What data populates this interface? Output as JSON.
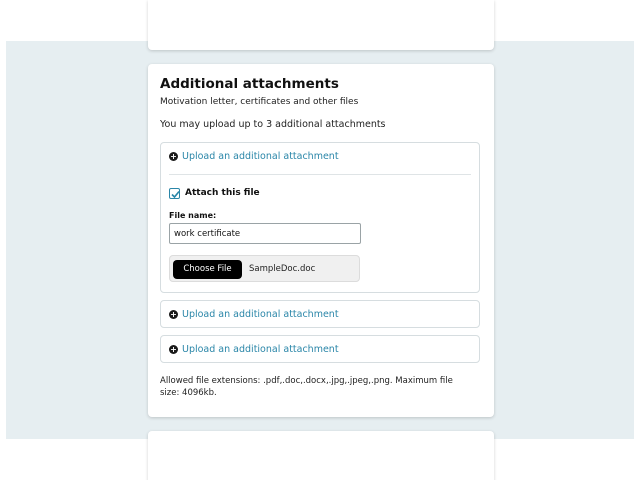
{
  "section": {
    "title": "Additional attachments",
    "subtitle": "Motivation letter, certificates and other files",
    "info": "You may upload up to 3 additional attachments"
  },
  "attachments": [
    {
      "link_label": "Upload an additional attachment",
      "attach_label": "Attach this file",
      "attach_checked": true,
      "file_name_label": "File name:",
      "file_name_value": "work certificate",
      "choose_file_label": "Choose File",
      "selected_file": "SampleDoc.doc"
    },
    {
      "link_label": "Upload an additional attachment"
    },
    {
      "link_label": "Upload an additional attachment"
    }
  ],
  "allowed_extensions_text": "Allowed file extensions: .pdf,.doc,.docx,.jpg,.jpeg,.png. Maximum file size: 4096kb.",
  "colors": {
    "accent": "#2a86a8",
    "band_background": "#e6eef1"
  },
  "icons": {
    "upload": "plus-circle-icon",
    "checkbox": "checkmark-icon"
  }
}
